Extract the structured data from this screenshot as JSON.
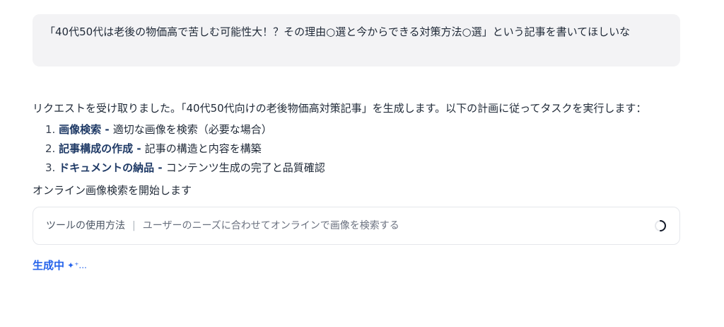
{
  "user_message": {
    "text": "「40代50代は老後の物価高で苦しむ可能性大！？その理由○選と今からできる対策方法○選」という記事を書いてほしいな"
  },
  "assistant": {
    "intro": "リクエストを受け取りました。「40代50代向けの老後物価高対策記事」を生成します。以下の計画に従ってタスクを実行します：",
    "plan": [
      {
        "num": "1.",
        "title": "画像検索",
        "sep": " - ",
        "desc": "適切な画像を検索（必要な場合）"
      },
      {
        "num": "2.",
        "title": "記事構成の作成",
        "sep": " - ",
        "desc": "記事の構造と内容を構築"
      },
      {
        "num": "3.",
        "title": "ドキュメントの納品",
        "sep": " - ",
        "desc": "コンテンツ生成の完了と品質確認"
      }
    ],
    "status": "オンライン画像検索を開始します"
  },
  "tool_card": {
    "label": "ツールの使用方法",
    "divider": "|",
    "description": "ユーザーのニーズに合わせてオンラインで画像を検索する",
    "icon": "spinner-icon"
  },
  "generating": {
    "label": "生成中",
    "icon": "sparkle-icon",
    "dots": "..."
  },
  "colors": {
    "bubble_bg": "#f3f3f5",
    "step_title": "#1f3a66",
    "accent": "#2563eb"
  }
}
